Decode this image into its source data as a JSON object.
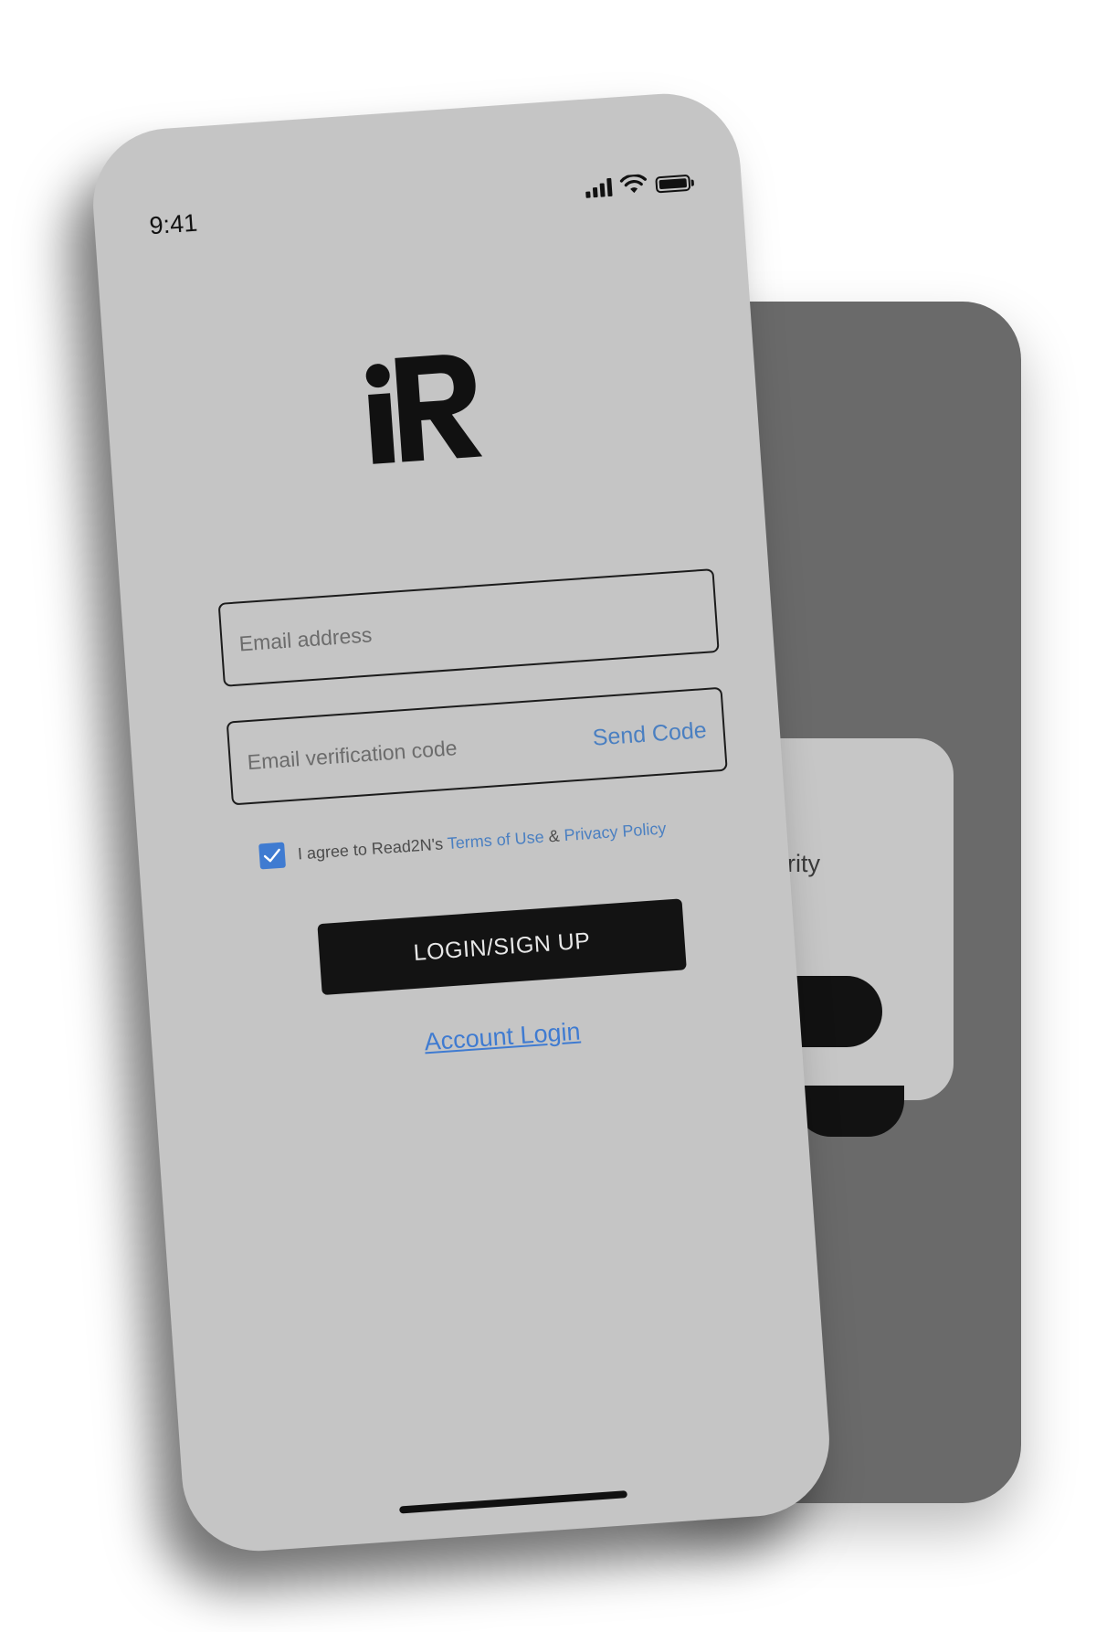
{
  "status_bar": {
    "time": "9:41"
  },
  "logo": {
    "text": "iR"
  },
  "form": {
    "email_placeholder": "Email address",
    "code_placeholder": "Email verification code",
    "send_code_label": "Send Code"
  },
  "agreement": {
    "checked": true,
    "prefix": "I agree to Read2N's",
    "terms_label": "Terms of Use",
    "and": "&",
    "privacy_label": "Privacy Policy"
  },
  "actions": {
    "primary_label": "LOGIN/SIGN UP",
    "account_login_label": "Account Login"
  },
  "background_screen": {
    "partial_text": "rity"
  },
  "colors": {
    "accent": "#3f7bd1",
    "link": "#4a7fc1",
    "screen_bg": "#c5c5c5",
    "back_phone": "#6a6a6a",
    "button_bg": "#131313"
  },
  "icons": {
    "signal": "cellular-signal-icon",
    "wifi": "wifi-icon",
    "battery": "battery-icon",
    "check": "checkmark-icon"
  }
}
